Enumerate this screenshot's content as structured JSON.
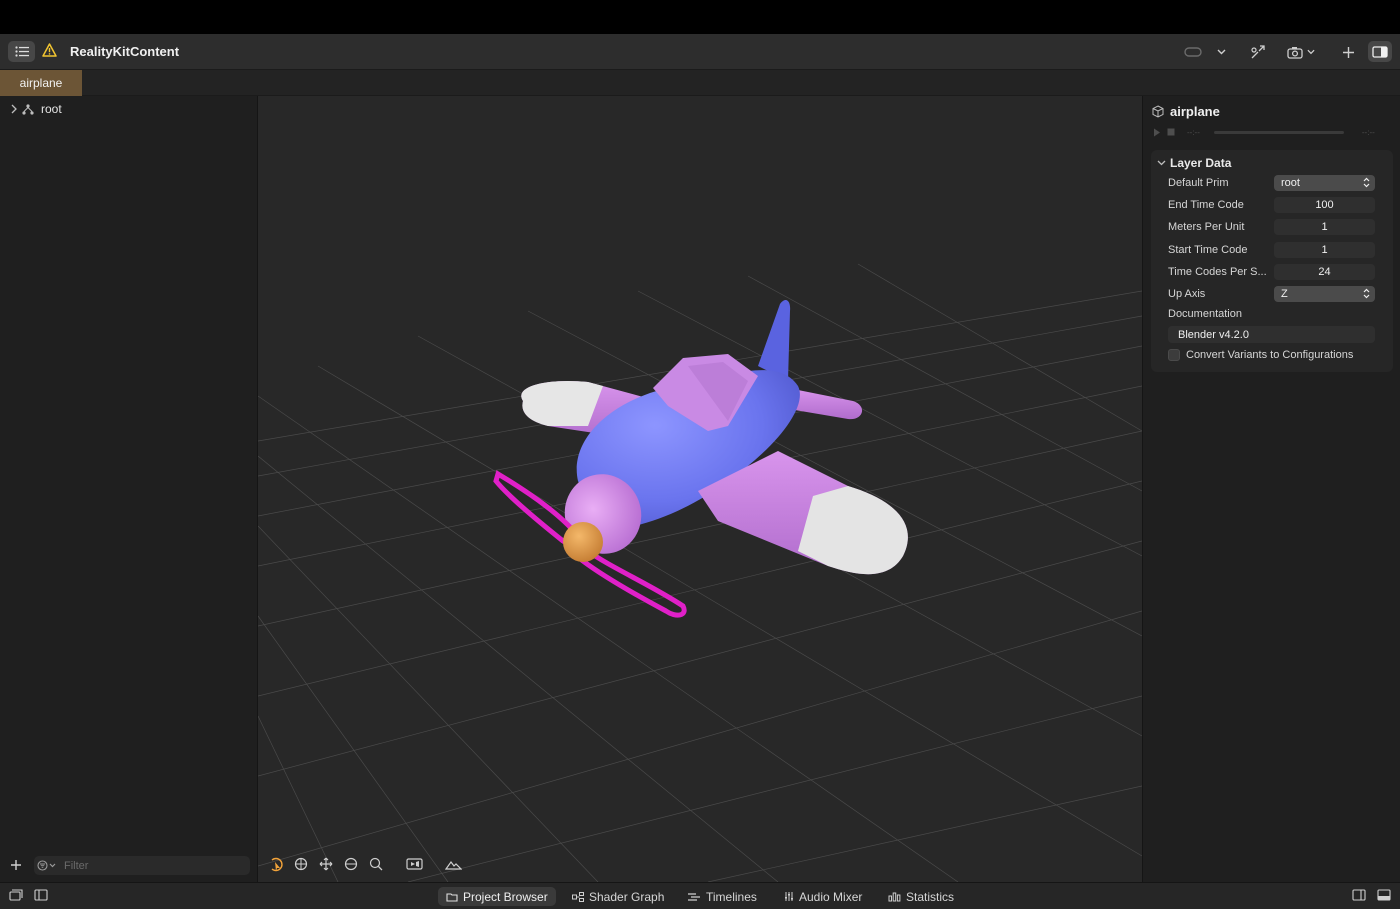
{
  "window": {
    "title": "RealityKitContent",
    "tab_label": "airplane"
  },
  "toolbar": {
    "icons": [
      "sidebar-toggle-icon",
      "warning-icon",
      "vision-pro-icon",
      "chevron-down-icon",
      "play-to-device-icon",
      "camera-icon",
      "plus-icon",
      "inspector-toggle-icon"
    ]
  },
  "navigator": {
    "tree": [
      {
        "label": "root",
        "expanded": false
      }
    ],
    "filter_placeholder": "Filter"
  },
  "viewport": {
    "tools": [
      "select-tool-icon",
      "rotate-tool-icon",
      "move-tool-icon",
      "orbit-tool-icon",
      "zoom-tool-icon",
      "camera-view-icon",
      "environment-icon"
    ],
    "active_tool": "select-tool-icon",
    "colors": {
      "body": "#6a74ee",
      "wings": "#c97ae0",
      "wing_tips": "#e4e4e4",
      "propeller": "#e020c8",
      "hub": "#e39a4a",
      "background": "#282828",
      "grid": "#5a5a5a"
    }
  },
  "inspector": {
    "title": "airplane",
    "section_title": "Layer Data",
    "properties": [
      {
        "label": "Default Prim",
        "value": "root",
        "type": "select"
      },
      {
        "label": "End Time Code",
        "value": "100",
        "type": "field"
      },
      {
        "label": "Meters Per Unit",
        "value": "1",
        "type": "field"
      },
      {
        "label": "Start Time Code",
        "value": "1",
        "type": "field"
      },
      {
        "label": "Time Codes Per S...",
        "value": "24",
        "type": "field"
      },
      {
        "label": "Up Axis",
        "value": "Z",
        "type": "select"
      }
    ],
    "documentation_label": "Documentation",
    "documentation_value": "Blender v4.2.0",
    "checkbox_label": "Convert Variants to Configurations",
    "checkbox_checked": false,
    "time_start": "--:--",
    "time_end": "--:--"
  },
  "bottom_tabs": [
    {
      "label": "Project Browser",
      "active": true
    },
    {
      "label": "Shader Graph",
      "active": false
    },
    {
      "label": "Timelines",
      "active": false
    },
    {
      "label": "Audio Mixer",
      "active": false
    },
    {
      "label": "Statistics",
      "active": false
    }
  ]
}
